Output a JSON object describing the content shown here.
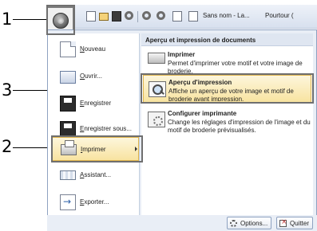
{
  "quick_access": {
    "title_part1": "Sans nom - La...",
    "title_part2": "Pourtour ("
  },
  "callouts": {
    "c1": "1",
    "c2": "2",
    "c3": "3"
  },
  "app_menu": {
    "items": [
      {
        "label": "Nouveau",
        "icon": "new-document-icon"
      },
      {
        "label": "Ouvrir...",
        "icon": "open-folder-icon"
      },
      {
        "label": "Enregistrer",
        "icon": "save-icon"
      },
      {
        "label": "Enregistrer sous...",
        "icon": "save-as-icon"
      },
      {
        "label": "Imprimer",
        "icon": "print-icon"
      },
      {
        "label": "Assistant...",
        "icon": "wizard-icon"
      },
      {
        "label": "Exporter...",
        "icon": "export-icon"
      }
    ]
  },
  "print_panel": {
    "header": "Aperçu et impression de documents",
    "items": [
      {
        "title": "Imprimer",
        "desc": "Permet d'imprimer votre motif et votre image de broderie.",
        "icon": "printer-icon"
      },
      {
        "title": "Aperçu d'impression",
        "desc": "Affiche un aperçu de votre image et motif de broderie avant impression.",
        "icon": "print-preview-icon"
      },
      {
        "title": "Configurer imprimante",
        "desc": "Change les réglages d'impression de l'image et du motif de broderie prévisualisés.",
        "icon": "printer-settings-icon"
      }
    ]
  },
  "footer": {
    "options_label": "Options...",
    "quit_label": "Quitter"
  }
}
